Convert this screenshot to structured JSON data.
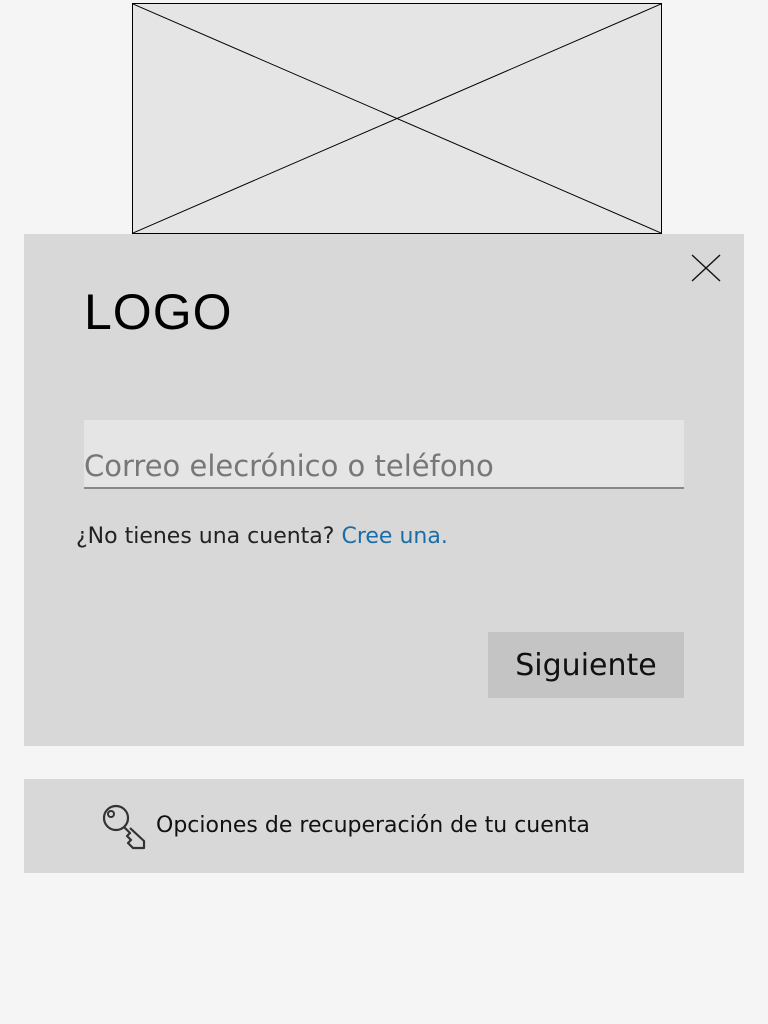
{
  "logo": {
    "text": "LOGO"
  },
  "login": {
    "email_placeholder": "Correo elecrónico o teléfono",
    "no_account_text": "¿No tienes una cuenta?",
    "create_link": "Cree una.",
    "next_label": "Siguiente"
  },
  "recovery": {
    "label": "Opciones de recuperación de tu cuenta"
  },
  "icons": {
    "close": "close-icon",
    "key": "key-icon",
    "image": "image-placeholder"
  },
  "colors": {
    "link": "#1a6ea8",
    "card": "#d8d8d8",
    "button": "#c4c4c4",
    "page": "#f5f5f5"
  }
}
